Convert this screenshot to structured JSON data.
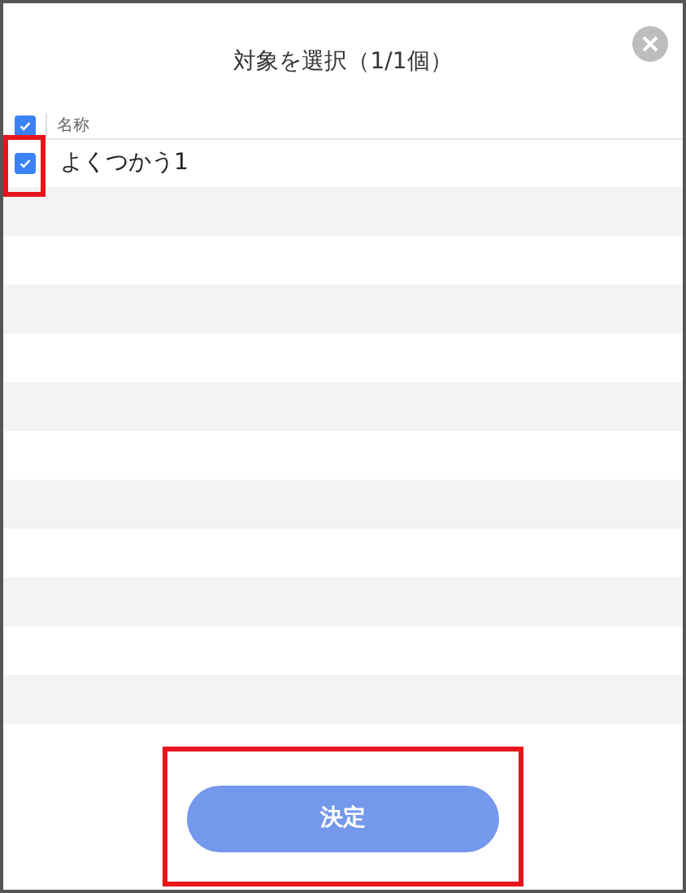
{
  "title": "対象を選択（1/1個）",
  "header": {
    "checked": true,
    "label": "名称"
  },
  "rows": [
    {
      "name": "よくつかう1",
      "checked": true,
      "highlighted": true
    }
  ],
  "confirm_button": {
    "label": "決定",
    "highlighted": true
  }
}
